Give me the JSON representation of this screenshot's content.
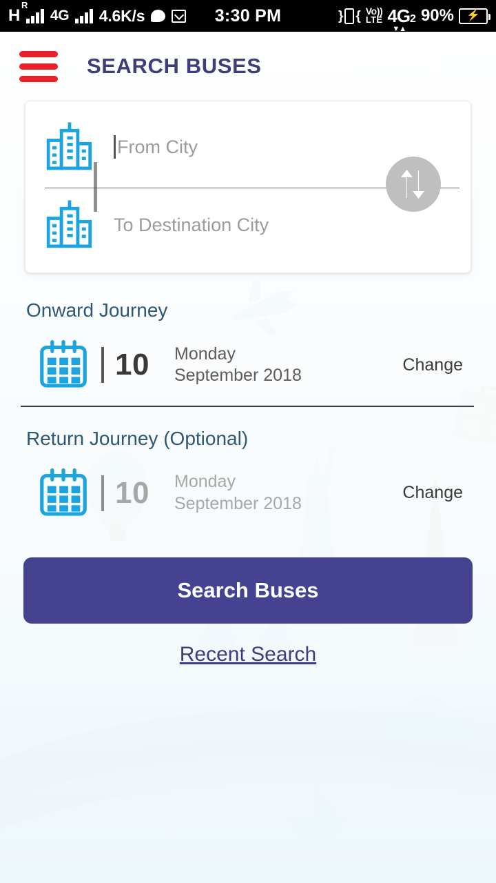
{
  "status_bar": {
    "network_letter": "H",
    "roaming_sup": "R",
    "network_type": "4G",
    "data_speed": "4.6K/s",
    "chat_icon": "chat-bubble-icon",
    "mail_icon": "mail-icon",
    "clock": "3:30 PM",
    "vibrate_icon": "vibrate-icon",
    "volte_line1": "Vo))",
    "volte_line2": "LTE",
    "sim2_big": "4G",
    "sim2_sub": "2",
    "sim2_arrows": "▼▲",
    "battery_percent": "90%",
    "battery_icon": "battery-charging-icon"
  },
  "app_bar": {
    "menu_icon": "hamburger-menu-icon",
    "title": "SEARCH BUSES"
  },
  "search_card": {
    "from": {
      "icon": "city-buildings-icon",
      "placeholder": "From City",
      "value": "",
      "focused": true
    },
    "to": {
      "icon": "city-buildings-icon",
      "placeholder": "To Destination City",
      "value": ""
    },
    "swap_icon": "swap-vertical-arrows-icon"
  },
  "onward_journey": {
    "heading": "Onward Journey",
    "calendar_icon": "calendar-icon",
    "day": "10",
    "weekday": "Monday",
    "month_year": "September 2018",
    "change_label": "Change"
  },
  "return_journey": {
    "heading": "Return Journey (Optional)",
    "calendar_icon": "calendar-icon",
    "day": "10",
    "weekday": "Monday",
    "month_year": "September 2018",
    "change_label": "Change"
  },
  "actions": {
    "search_label": "Search Buses",
    "recent_search_label": "Recent Search"
  },
  "colors": {
    "brand_indigo": "#454391",
    "title_indigo": "#3f3d7c",
    "menu_red": "#e62129",
    "icon_blue": "#1ca4e0",
    "heading_blue": "#2e5777",
    "swap_gray": "#bfbfbf"
  }
}
